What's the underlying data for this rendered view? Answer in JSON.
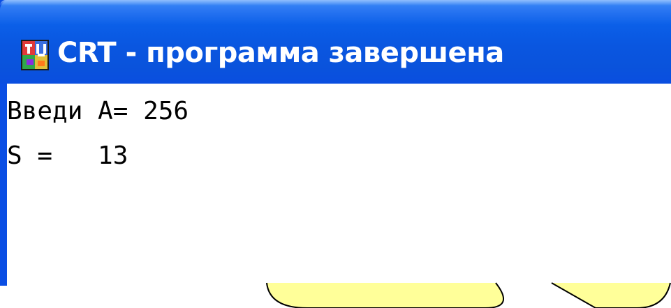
{
  "window": {
    "title": "CRT - программа завершена",
    "icon": "turbo-pascal-app-icon"
  },
  "console": {
    "lines": [
      "Введи A= 256",
      "S =   13"
    ]
  },
  "colors": {
    "titlebar": "#0a56e0",
    "window_border": "#0a4ee4",
    "title_text": "#ffffff",
    "console_background": "#ffffff",
    "console_text": "#000000",
    "callout_fill": "#ffff99",
    "callout_stroke": "#000000"
  }
}
